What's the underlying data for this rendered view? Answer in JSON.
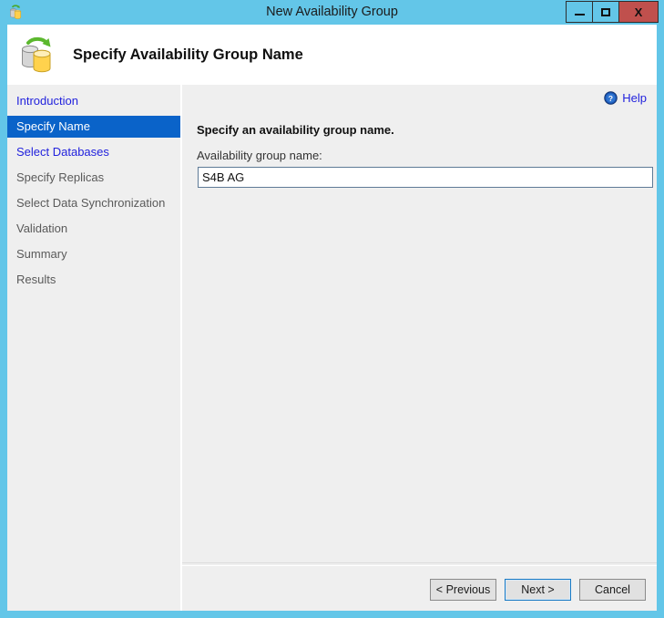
{
  "window": {
    "title": "New Availability Group",
    "app_icon": "database-replication-icon",
    "controls": {
      "minimize_label": "–",
      "maximize_label": "□",
      "close_label": "X"
    }
  },
  "header": {
    "icon": "database-replication-icon",
    "title": "Specify Availability Group Name"
  },
  "sidebar": {
    "items": [
      {
        "label": "Introduction",
        "state": "link"
      },
      {
        "label": "Specify Name",
        "state": "selected"
      },
      {
        "label": "Select Databases",
        "state": "link"
      },
      {
        "label": "Specify Replicas",
        "state": "disabled"
      },
      {
        "label": "Select Data Synchronization",
        "state": "disabled"
      },
      {
        "label": "Validation",
        "state": "disabled"
      },
      {
        "label": "Summary",
        "state": "disabled"
      },
      {
        "label": "Results",
        "state": "disabled"
      }
    ]
  },
  "content": {
    "help": {
      "label": "Help",
      "icon": "help-question-icon"
    },
    "heading": "Specify an availability group name.",
    "field_label": "Availability group name:",
    "field_value": "S4B AG",
    "field_placeholder": ""
  },
  "footer": {
    "previous_label": "< Previous",
    "next_label": "Next >",
    "cancel_label": "Cancel"
  },
  "colors": {
    "chrome": "#63c6e8",
    "close_button": "#c0504d",
    "selected_nav": "#0a63c9",
    "link": "#2222dd",
    "panel": "#efefef"
  }
}
